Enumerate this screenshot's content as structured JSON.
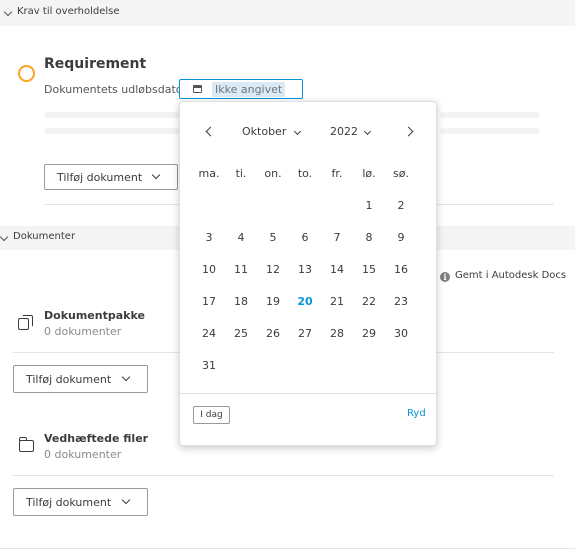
{
  "section_compliance": {
    "label": "Krav til overholdelse"
  },
  "requirement": {
    "title": "Requirement",
    "date_label": "Dokumentets udløbsdato:",
    "date_value": "Ikke angivet",
    "status_color": "#f5a623"
  },
  "add_document_label": "Tilføj dokument",
  "section_documents": {
    "label": "Dokumenter"
  },
  "saved_note": "Gemt i Autodesk Docs",
  "document_package": {
    "title": "Dokumentpakke",
    "count": "0 dokumenter"
  },
  "attached_files": {
    "title": "Vedhæftede filer",
    "count": "0 dokumenter"
  },
  "calendar": {
    "month": "Oktober",
    "year": "2022",
    "weekdays": [
      "ma.",
      "ti.",
      "on.",
      "to.",
      "fr.",
      "lø.",
      "sø."
    ],
    "weeks": [
      [
        "",
        "",
        "",
        "",
        "",
        "1",
        "2"
      ],
      [
        "3",
        "4",
        "5",
        "6",
        "7",
        "8",
        "9"
      ],
      [
        "10",
        "11",
        "12",
        "13",
        "14",
        "15",
        "16"
      ],
      [
        "17",
        "18",
        "19",
        "20",
        "21",
        "22",
        "23"
      ],
      [
        "24",
        "25",
        "26",
        "27",
        "28",
        "29",
        "30"
      ],
      [
        "31",
        "",
        "",
        "",
        "",
        "",
        ""
      ]
    ],
    "today": "20",
    "today_button": "I dag",
    "clear_link": "Ryd",
    "accent_color": "#0696d7"
  }
}
